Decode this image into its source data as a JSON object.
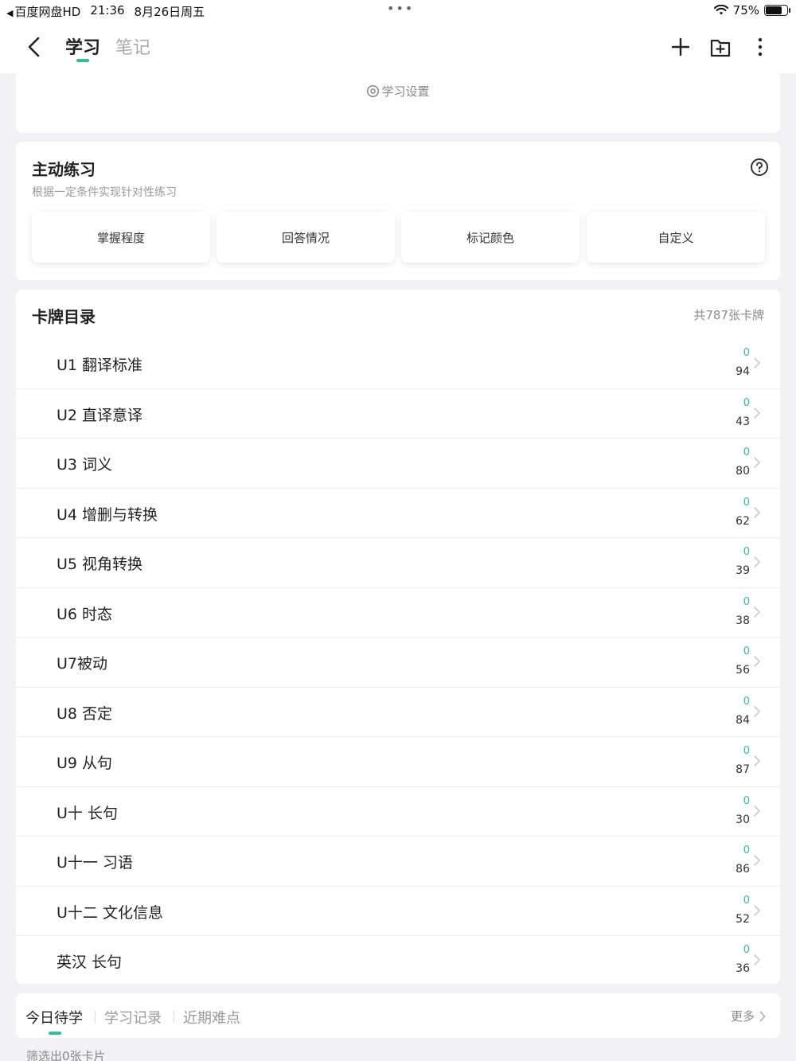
{
  "status_bar": {
    "back_app": "百度网盘HD",
    "time": "21:36",
    "date": "8月26日周五",
    "multitask_dots": "•••",
    "battery_text": "75%",
    "battery_level": 0.75
  },
  "nav": {
    "tab_active": "学习",
    "tab_inactive": "笔记",
    "icons": [
      "back-icon",
      "plus-icon",
      "folder-add-icon",
      "more-vertical-icon"
    ]
  },
  "settings": {
    "label": "学习设置"
  },
  "practice": {
    "title": "主动练习",
    "subtitle": "根据一定条件实现针对性练习",
    "buttons": [
      "掌握程度",
      "回答情况",
      "标记颜色",
      "自定义"
    ]
  },
  "catalog": {
    "title": "卡牌目录",
    "count": "共787张卡牌",
    "units": [
      {
        "name": "U1 翻译标准",
        "new": "0",
        "total": "94"
      },
      {
        "name": "U2 直译意译",
        "new": "0",
        "total": "43"
      },
      {
        "name": "U3 词义",
        "new": "0",
        "total": "80"
      },
      {
        "name": "U4 增删与转换",
        "new": "0",
        "total": "62"
      },
      {
        "name": "U5 视角转换",
        "new": "0",
        "total": "39"
      },
      {
        "name": "U6 时态",
        "new": "0",
        "total": "38"
      },
      {
        "name": "U7被动",
        "new": "0",
        "total": "56"
      },
      {
        "name": "U8 否定",
        "new": "0",
        "total": "84"
      },
      {
        "name": "U9 从句",
        "new": "0",
        "total": "87"
      },
      {
        "name": "U十 长句",
        "new": "0",
        "total": "30"
      },
      {
        "name": "U十一 习语",
        "new": "0",
        "total": "86"
      },
      {
        "name": "U十二 文化信息",
        "new": "0",
        "total": "52"
      },
      {
        "name": "英汉 长句",
        "new": "0",
        "total": "36"
      }
    ]
  },
  "bottom_tabs": {
    "tabs": [
      "今日待学",
      "学习记录",
      "近期难点"
    ],
    "more": "更多"
  },
  "filter": {
    "text": "筛选出0张卡片"
  },
  "colors": {
    "accent": "#2dbf9f",
    "background": "#f2f2f4"
  }
}
